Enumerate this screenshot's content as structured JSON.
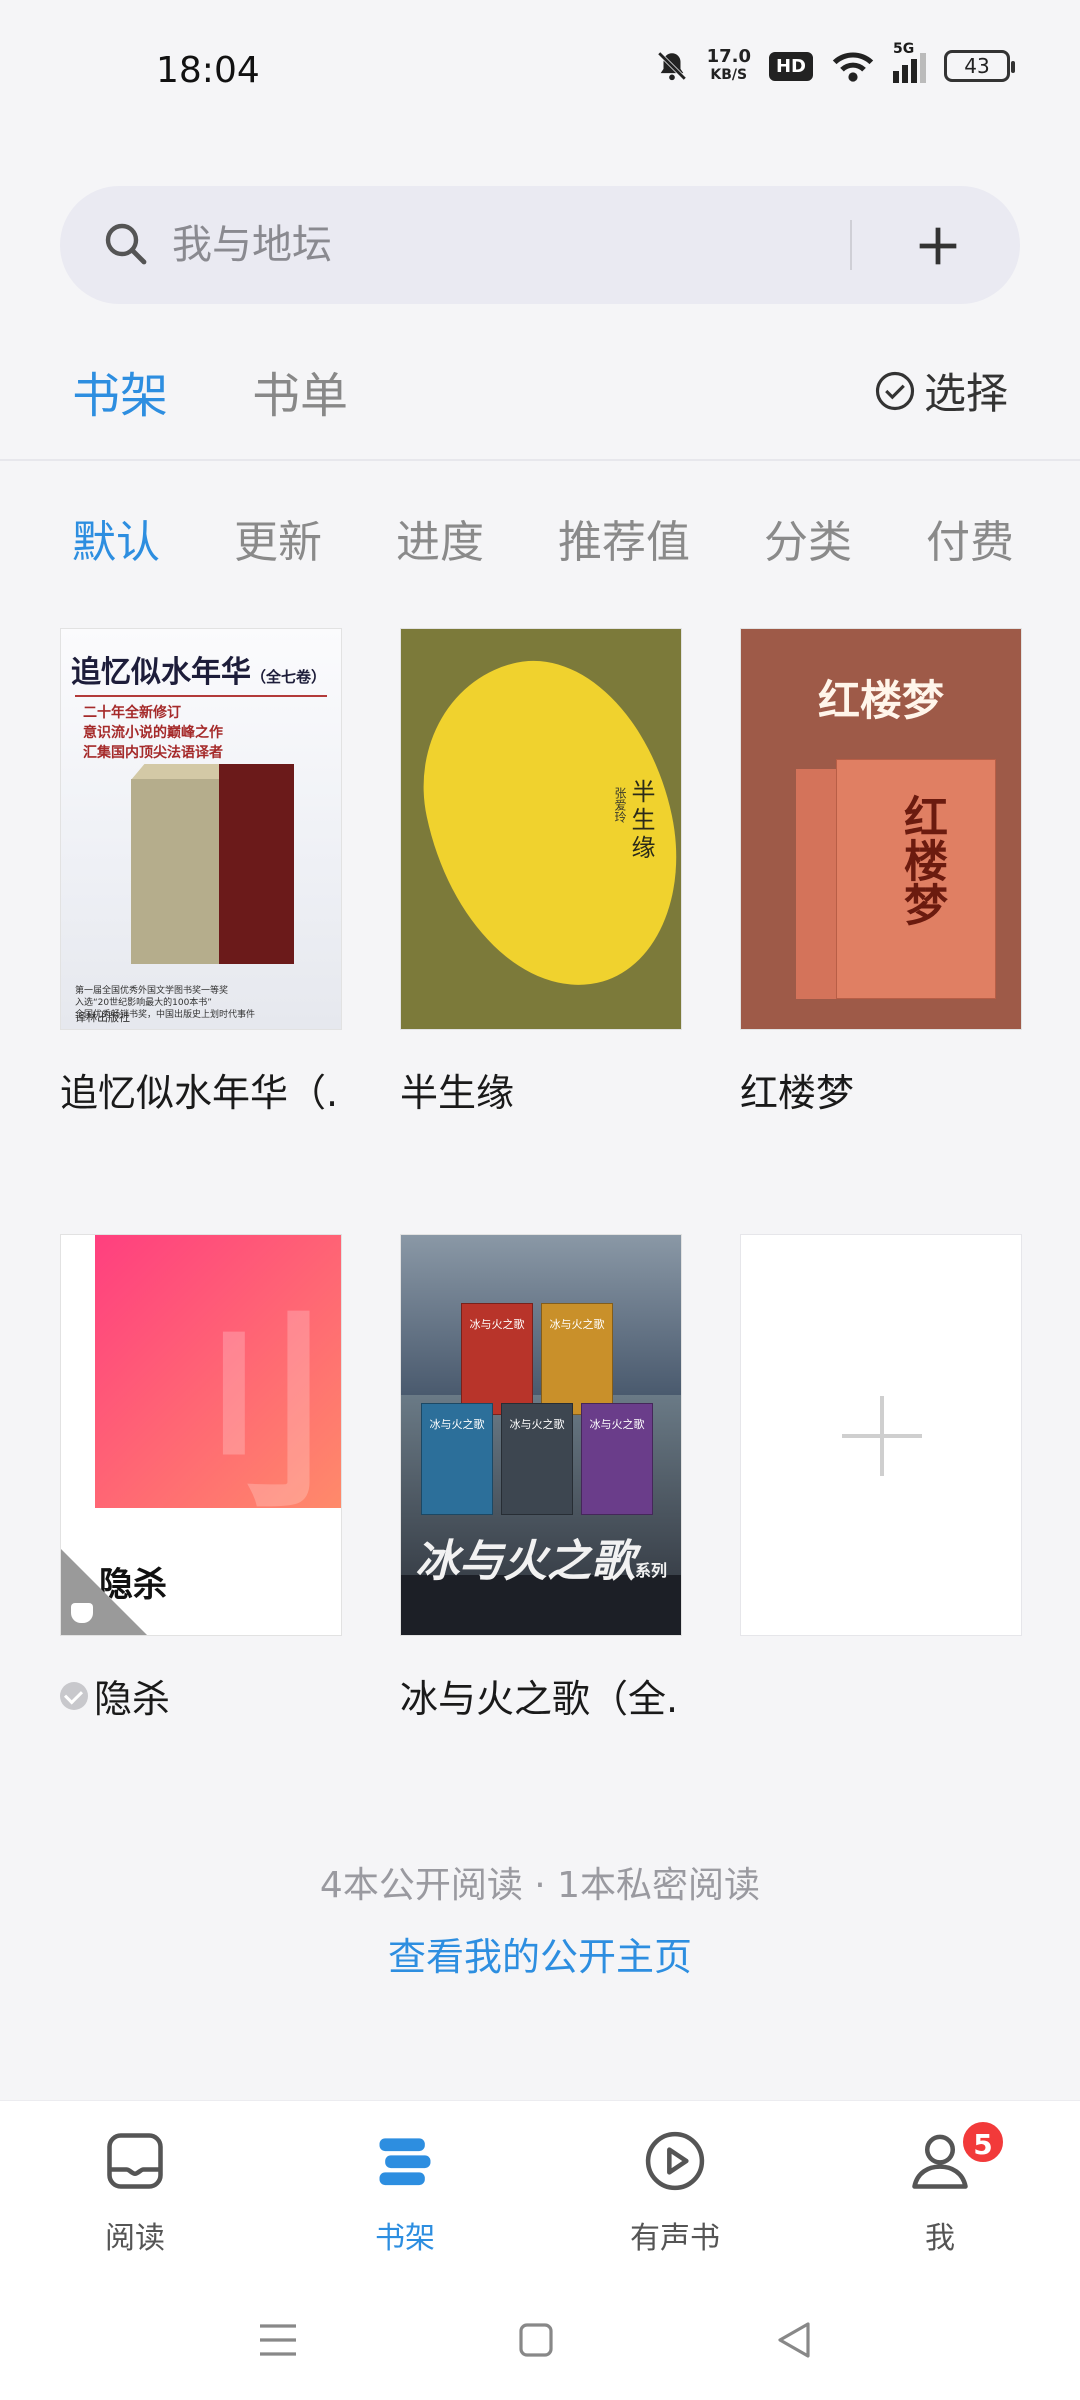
{
  "status_bar": {
    "time": "18:04",
    "net_speed_value": "17.0",
    "net_speed_unit": "KB/S",
    "hd_label": "HD",
    "signal_label": "5G",
    "battery": "43"
  },
  "search": {
    "placeholder": "我与地坛"
  },
  "main_tabs": [
    {
      "label": "书架",
      "active": true
    },
    {
      "label": "书单",
      "active": false
    }
  ],
  "select_label": "选择",
  "sort_tabs": [
    {
      "label": "默认",
      "active": true
    },
    {
      "label": "更新",
      "active": false
    },
    {
      "label": "进度",
      "active": false
    },
    {
      "label": "推荐值",
      "active": false
    },
    {
      "label": "分类",
      "active": false
    },
    {
      "label": "付费",
      "active": false
    }
  ],
  "books": [
    {
      "title": "追忆似水年华（...",
      "cover": {
        "heading": "追忆似水年华",
        "heading_small": "（全七卷）",
        "lines": [
          "二十年全新修订",
          "意识流小说的巅峰之作",
          "汇集国内顶尖法语译者"
        ],
        "footer": [
          "第一届全国优秀外国文学图书奖一等奖",
          "入选“20世纪影响最大的100本书”",
          "全国优秀畅销书奖，中国出版史上划时代事件"
        ],
        "publisher": "译林出版社"
      }
    },
    {
      "title": "半生缘",
      "cover": {
        "heading": "半生缘",
        "author": "张爱玲"
      }
    },
    {
      "title": "红楼梦",
      "cover": {
        "heading": "红楼梦",
        "box_text": "红楼梦"
      }
    },
    {
      "title": "隐杀",
      "private": true,
      "cover": {
        "heading": "隐杀"
      }
    },
    {
      "title": "冰与火之歌（全...",
      "cover": {
        "heading": "冰与火之歌",
        "heading_small": "系列",
        "box_label": "冰与火之歌"
      }
    }
  ],
  "stats_text": "4本公开阅读 · 1本私密阅读",
  "public_link": "查看我的公开主页",
  "bottom_nav": [
    {
      "label": "阅读",
      "active": false
    },
    {
      "label": "书架",
      "active": true
    },
    {
      "label": "有声书",
      "active": false
    },
    {
      "label": "我",
      "active": false,
      "badge": "5"
    }
  ],
  "colors": {
    "accent": "#2d8ee0",
    "badge": "#f23a3a"
  }
}
